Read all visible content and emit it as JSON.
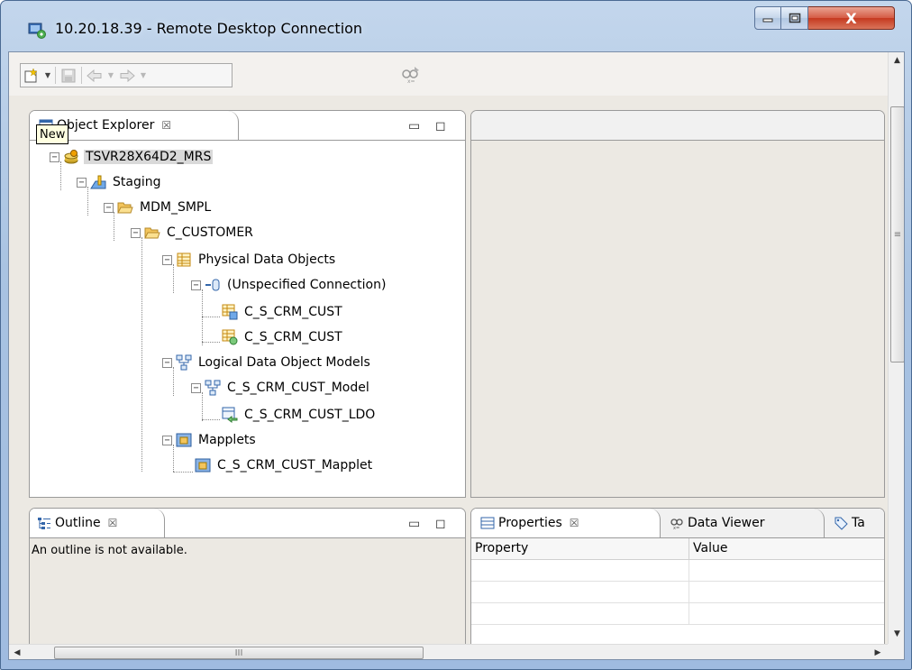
{
  "window": {
    "title": "10.20.18.39 - Remote Desktop Connection",
    "close_glyph": "X"
  },
  "tooltip": {
    "text": "New"
  },
  "explorer": {
    "tab_label": "Object Explorer",
    "tree": [
      {
        "label": "TSVR28X64D2_MRS",
        "icon": "repository-icon"
      },
      {
        "label": "Staging",
        "icon": "project-icon"
      },
      {
        "label": "MDM_SMPL",
        "icon": "folder-open-icon"
      },
      {
        "label": "C_CUSTOMER",
        "icon": "folder-open-icon"
      },
      {
        "label": "Physical Data Objects",
        "icon": "table-icon"
      },
      {
        "label": "(Unspecified Connection)",
        "icon": "database-connection-icon"
      },
      {
        "label": "C_S_CRM_CUST",
        "icon": "data-object-icon"
      },
      {
        "label": "C_S_CRM_CUST",
        "icon": "customized-data-object-icon"
      },
      {
        "label": "Logical Data Object Models",
        "icon": "model-icon"
      },
      {
        "label": "C_S_CRM_CUST_Model",
        "icon": "model-icon"
      },
      {
        "label": "C_S_CRM_CUST_LDO",
        "icon": "logical-data-object-icon"
      },
      {
        "label": "Mapplets",
        "icon": "mapplet-icon"
      },
      {
        "label": "C_S_CRM_CUST_Mapplet",
        "icon": "mapplet-icon"
      }
    ]
  },
  "outline": {
    "tab_label": "Outline",
    "message": "An outline is not available."
  },
  "properties": {
    "tabs": [
      {
        "label": "Properties",
        "icon": "properties-icon"
      },
      {
        "label": "Data Viewer",
        "icon": "data-viewer-icon"
      },
      {
        "label": "Ta",
        "icon": "tag-icon"
      }
    ],
    "columns": [
      "Property",
      "Value"
    ]
  },
  "scrollbar": {
    "thumb_glyph": "≡",
    "h_thumb_glyph": "III"
  },
  "colors": {
    "selection": "#d9d9d9",
    "tooltip_bg": "#ffffe1",
    "close_red": "#c53a20"
  }
}
